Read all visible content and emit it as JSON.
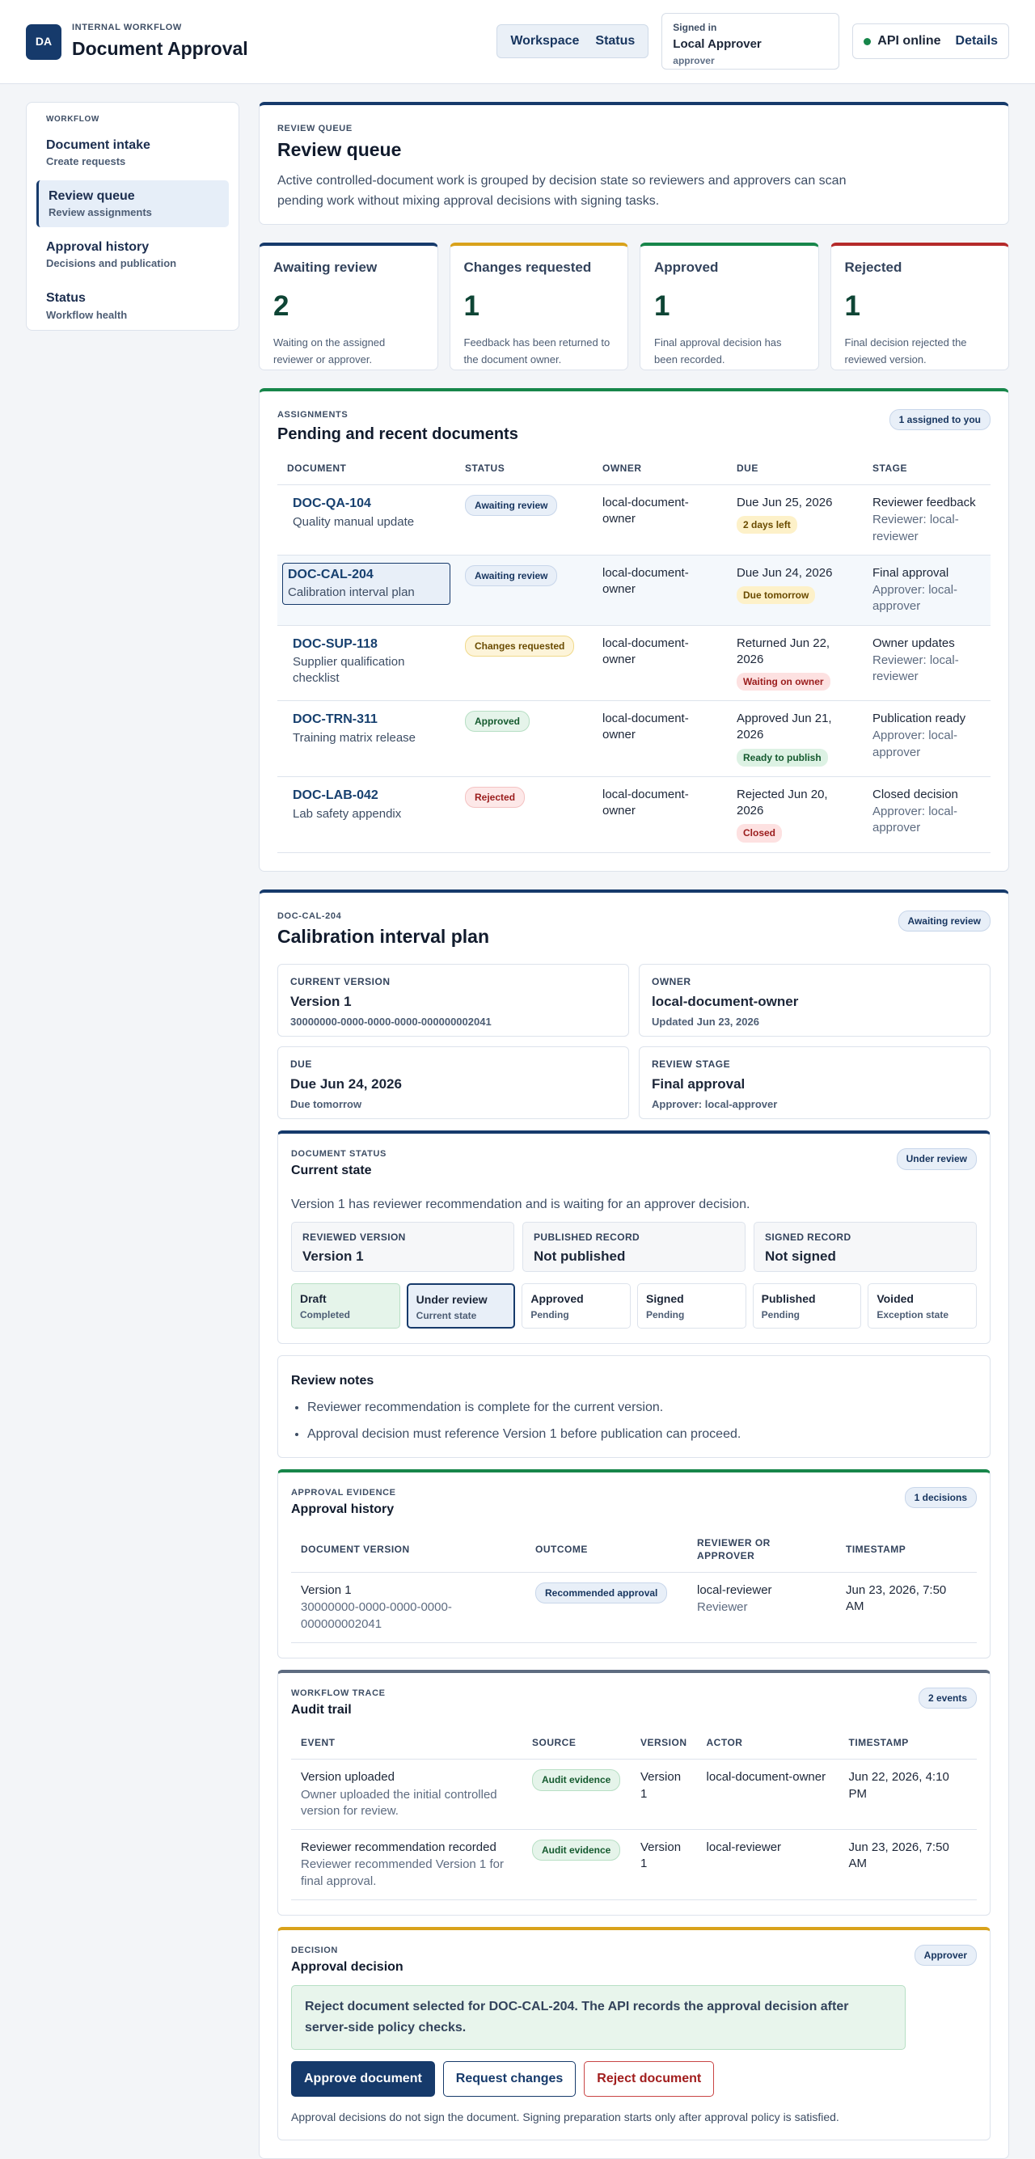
{
  "app": {
    "logo": "DA",
    "eyebrow": "INTERNAL WORKFLOW",
    "title": "Document Approval"
  },
  "topnav": {
    "workspace": "Workspace",
    "status": "Status"
  },
  "signed_in": {
    "label": "Signed in",
    "name": "Local Approver",
    "role": "approver"
  },
  "api": {
    "label": "API online",
    "details": "Details",
    "status_color": "#17864a"
  },
  "sidebar": {
    "heading": "WORKFLOW",
    "items": [
      {
        "label": "Document intake",
        "sub": "Create requests"
      },
      {
        "label": "Review queue",
        "sub": "Review assignments"
      },
      {
        "label": "Approval history",
        "sub": "Decisions and publication"
      },
      {
        "label": "Status",
        "sub": "Workflow health"
      }
    ]
  },
  "intro": {
    "eyebrow": "REVIEW QUEUE",
    "title": "Review queue",
    "text": "Active controlled-document work is grouped by decision state so reviewers and approvers can scan pending work without mixing approval decisions with signing tasks."
  },
  "metrics": [
    {
      "label": "Awaiting review",
      "value": "2",
      "note": "Waiting on the assigned reviewer or approver.",
      "color": "#163a6b"
    },
    {
      "label": "Changes requested",
      "value": "1",
      "note": "Feedback has been returned to the document owner.",
      "color": "#d9a21b"
    },
    {
      "label": "Approved",
      "value": "1",
      "note": "Final approval decision has been recorded.",
      "color": "#17864a"
    },
    {
      "label": "Rejected",
      "value": "1",
      "note": "Final decision rejected the reviewed version.",
      "color": "#b52a2a"
    }
  ],
  "assignments": {
    "eyebrow": "ASSIGNMENTS",
    "title": "Pending and recent documents",
    "badge": "1 assigned to you",
    "columns": [
      "DOCUMENT",
      "STATUS",
      "OWNER",
      "DUE",
      "STAGE"
    ],
    "rows": [
      {
        "id": "DOC-QA-104",
        "name": "Quality manual update",
        "status": "Awaiting review",
        "owner": "local-document-owner",
        "due": "Due Jun 25, 2026",
        "due_note": "2 days left",
        "stage": "Reviewer feedback",
        "stage_sub": "Reviewer: local-reviewer"
      },
      {
        "id": "DOC-CAL-204",
        "name": "Calibration interval plan",
        "status": "Awaiting review",
        "owner": "local-document-owner",
        "due": "Due Jun 24, 2026",
        "due_note": "Due tomorrow",
        "stage": "Final approval",
        "stage_sub": "Approver: local-approver"
      },
      {
        "id": "DOC-SUP-118",
        "name": "Supplier qualification checklist",
        "status": "Changes requested",
        "owner": "local-document-owner",
        "due": "Returned Jun 22, 2026",
        "due_note": "Waiting on owner",
        "stage": "Owner updates",
        "stage_sub": "Reviewer: local-reviewer"
      },
      {
        "id": "DOC-TRN-311",
        "name": "Training matrix release",
        "status": "Approved",
        "owner": "local-document-owner",
        "due": "Approved Jun 21, 2026",
        "due_note": "Ready to publish",
        "stage": "Publication ready",
        "stage_sub": "Approver: local-approver"
      },
      {
        "id": "DOC-LAB-042",
        "name": "Lab safety appendix",
        "status": "Rejected",
        "owner": "local-document-owner",
        "due": "Rejected Jun 20, 2026",
        "due_note": "Closed",
        "stage": "Closed decision",
        "stage_sub": "Approver: local-approver"
      }
    ]
  },
  "detail": {
    "eyebrow": "DOC-CAL-204",
    "title": "Calibration interval plan",
    "badge": "Awaiting review",
    "kv": [
      {
        "k": "CURRENT VERSION",
        "v": "Version 1",
        "n": "30000000-0000-0000-0000-000000002041"
      },
      {
        "k": "OWNER",
        "v": "local-document-owner",
        "n": "Updated Jun 23, 2026"
      },
      {
        "k": "DUE",
        "v": "Due Jun 24, 2026",
        "n": "Due tomorrow"
      },
      {
        "k": "REVIEW STAGE",
        "v": "Final approval",
        "n": "Approver: local-approver"
      }
    ]
  },
  "doc_status": {
    "eyebrow": "DOCUMENT STATUS",
    "title": "Current state",
    "badge": "Under review",
    "text": "Version 1 has reviewer recommendation and is waiting for an approver decision.",
    "records": [
      {
        "k": "REVIEWED VERSION",
        "v": "Version 1"
      },
      {
        "k": "PUBLISHED RECORD",
        "v": "Not published"
      },
      {
        "k": "SIGNED RECORD",
        "v": "Not signed"
      }
    ],
    "steps": [
      {
        "a": "Draft",
        "b": "Completed"
      },
      {
        "a": "Under review",
        "b": "Current state"
      },
      {
        "a": "Approved",
        "b": "Pending"
      },
      {
        "a": "Signed",
        "b": "Pending"
      },
      {
        "a": "Published",
        "b": "Pending"
      },
      {
        "a": "Voided",
        "b": "Exception state"
      }
    ]
  },
  "notes": {
    "title": "Review notes",
    "items": [
      "Reviewer recommendation is complete for the current version.",
      "Approval decision must reference Version 1 before publication can proceed."
    ]
  },
  "evidence": {
    "eyebrow": "APPROVAL EVIDENCE",
    "title": "Approval history",
    "badge": "1 decisions",
    "columns": [
      "DOCUMENT VERSION",
      "OUTCOME",
      "REVIEWER OR APPROVER",
      "TIMESTAMP"
    ],
    "rows": [
      {
        "version": "Version 1",
        "version_id": "30000000-0000-0000-0000-000000002041",
        "outcome": "Recommended approval",
        "actor": "local-reviewer",
        "role": "Reviewer",
        "time": "Jun 23, 2026, 7:50 AM"
      }
    ]
  },
  "trace": {
    "eyebrow": "WORKFLOW TRACE",
    "title": "Audit trail",
    "badge": "2 events",
    "columns": [
      "EVENT",
      "SOURCE",
      "VERSION",
      "ACTOR",
      "TIMESTAMP"
    ],
    "rows": [
      {
        "event": "Version uploaded",
        "desc": "Owner uploaded the initial controlled version for review.",
        "source": "Audit evidence",
        "version": "Version 1",
        "actor": "local-document-owner",
        "time": "Jun 22, 2026, 4:10 PM"
      },
      {
        "event": "Reviewer recommendation recorded",
        "desc": "Reviewer recommended Version 1 for final approval.",
        "source": "Audit evidence",
        "version": "Version 1",
        "actor": "local-reviewer",
        "time": "Jun 23, 2026, 7:50 AM"
      }
    ]
  },
  "decision": {
    "eyebrow": "DECISION",
    "title": "Approval decision",
    "badge": "Approver",
    "alert": "Reject document selected for DOC-CAL-204. The API records the approval decision after server-side policy checks.",
    "approve": "Approve document",
    "request": "Request changes",
    "reject": "Reject document",
    "footnote": "Approval decisions do not sign the document. Signing preparation starts only after approval policy is satisfied."
  }
}
